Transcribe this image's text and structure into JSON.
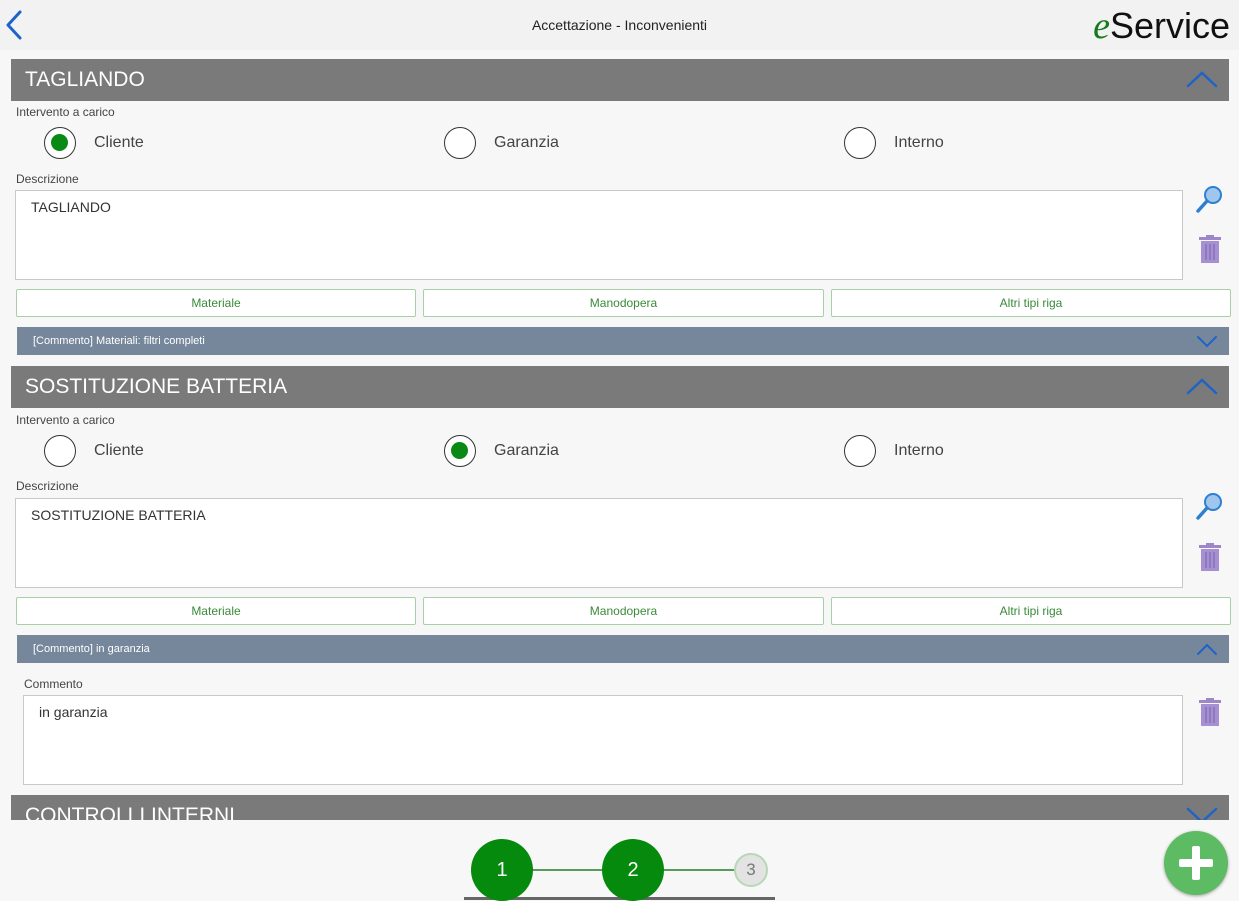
{
  "header": {
    "title": "Accettazione - Inconvenienti",
    "brand_e": "e",
    "brand_rest": "Service"
  },
  "sections": [
    {
      "title": "TAGLIANDO",
      "charge_label": "Intervento a carico",
      "options": [
        "Cliente",
        "Garanzia",
        "Interno"
      ],
      "selected": "Cliente",
      "desc_label": "Descrizione",
      "description": "TAGLIANDO",
      "buttons": [
        "Materiale",
        "Manodopera",
        "Altri tipi riga"
      ],
      "comment_bar": "[Commento] Materiali: filtri completi"
    },
    {
      "title": "SOSTITUZIONE BATTERIA",
      "charge_label": "Intervento a carico",
      "options": [
        "Cliente",
        "Garanzia",
        "Interno"
      ],
      "selected": "Garanzia",
      "desc_label": "Descrizione",
      "description": "SOSTITUZIONE BATTERIA",
      "buttons": [
        "Materiale",
        "Manodopera",
        "Altri tipi riga"
      ],
      "comment_bar": "[Commento] in garanzia",
      "comment_label": "Commento",
      "comment": "in garanzia"
    },
    {
      "title": "CONTROLLI INTERNI"
    }
  ],
  "steps": [
    "1",
    "2",
    "3"
  ],
  "colors": {
    "accent_green": "#068a0e",
    "header_gray": "#7a7a7a",
    "comment_bar": "#76879b",
    "chevron_blue": "#1e63c8"
  }
}
